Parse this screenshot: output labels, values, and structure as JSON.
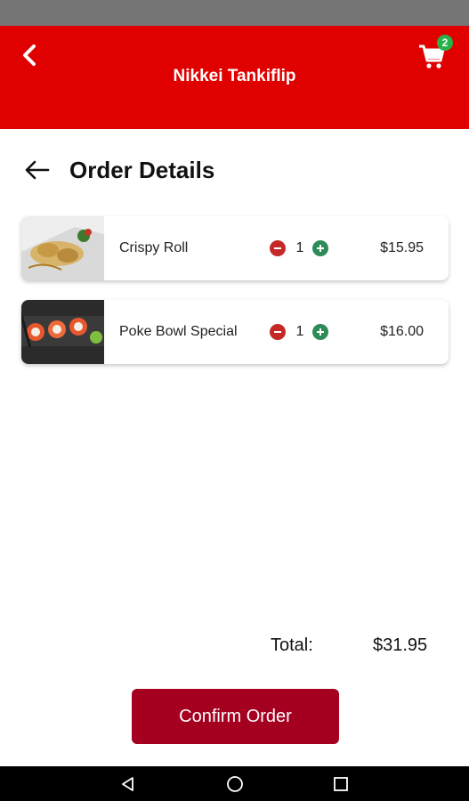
{
  "appbar": {
    "title": "Nikkei Tankiflip",
    "cart_count": "2"
  },
  "page": {
    "heading": "Order Details"
  },
  "items": [
    {
      "name": "Crispy Roll",
      "qty": "1",
      "price": "$15.95"
    },
    {
      "name": "Poke Bowl Special",
      "qty": "1",
      "price": "$16.00"
    }
  ],
  "summary": {
    "total_label": "Total:",
    "total_value": "$31.95"
  },
  "actions": {
    "confirm_label": "Confirm Order"
  },
  "colors": {
    "appbar": "#e00000",
    "confirm": "#a50020",
    "minus": "#c62828",
    "plus": "#2e8b57",
    "badge": "#27b34a"
  }
}
